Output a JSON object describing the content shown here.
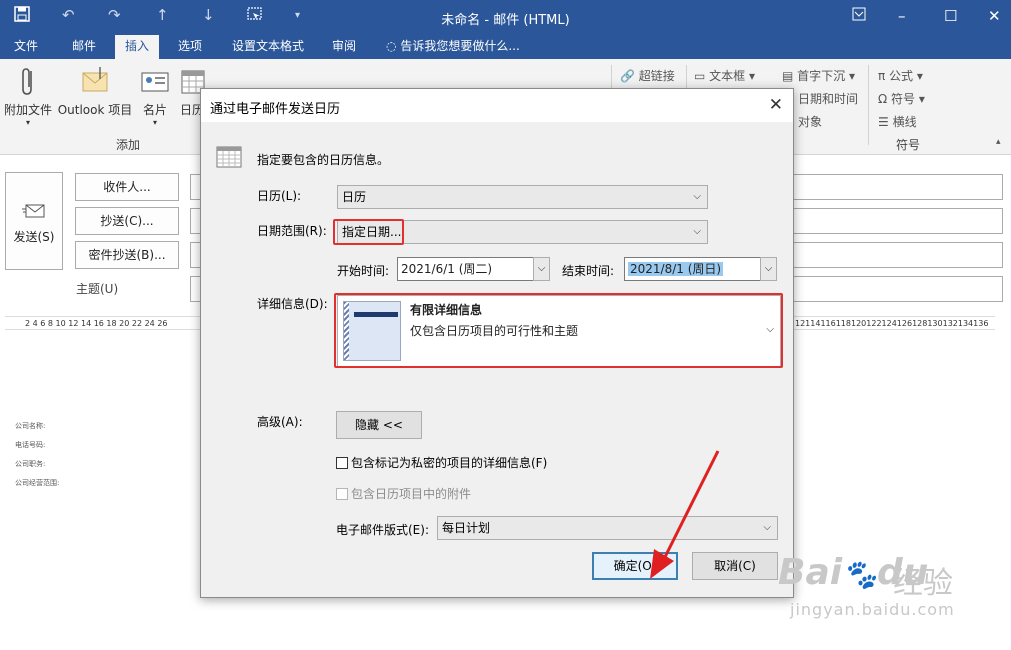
{
  "window": {
    "title": "未命名 - 邮件 (HTML)"
  },
  "ribbon_tabs": [
    "文件",
    "邮件",
    "插入",
    "选项",
    "设置文本格式",
    "审阅"
  ],
  "tell_me": "告诉我您想要做什么...",
  "ribbon": {
    "attach_file": "附加文件",
    "outlook_item": "Outlook 项目",
    "business_card": "名片",
    "calendar_short": "日历",
    "group_add": "添加",
    "hyperlink": "超链接",
    "textbox": "文本框",
    "dropcap": "首字下沉",
    "datetime": "日期和时间",
    "object": "对象",
    "equation": "公式",
    "symbol": "符号",
    "hline": "横线",
    "group_symbols": "符号"
  },
  "compose": {
    "send": "发送(S)",
    "to": "收件人...",
    "cc": "抄送(C)...",
    "bcc": "密件抄送(B)...",
    "subject": "主题(U)",
    "ruler_left": "2  4  6  8  10 12 14 16 18 20 22 24 26",
    "ruler_right": "12114116118120122124126128130132134136",
    "doc_lines": [
      "公司名称:",
      "电话号码:",
      "公司职务:",
      "公司经营范围:"
    ]
  },
  "dialog": {
    "title": "通过电子邮件发送日历",
    "intro": "指定要包含的日历信息。",
    "calendar_label": "日历(L):",
    "calendar_value": "日历",
    "range_label": "日期范围(R):",
    "range_value": "指定日期...",
    "start_label": "开始时间:",
    "start_value": "2021/6/1 (周二)",
    "end_label": "结束时间:",
    "end_value": "2021/8/1 (周日)",
    "detail_label": "详细信息(D):",
    "detail_title": "有限详细信息",
    "detail_desc": "仅包含日历项目的可行性和主题",
    "advanced_label": "高级(A):",
    "hide_button": "隐藏 <<",
    "private_check": "包含标记为私密的项目的详细信息(F)",
    "attach_check": "包含日历项目中的附件",
    "format_label": "电子邮件版式(E):",
    "format_value": "每日计划",
    "ok": "确定(O)",
    "cancel": "取消(C)"
  },
  "watermark": {
    "brand": "Bai",
    "brand2": "du",
    "cn": "经验",
    "url": "jingyan.baidu.com"
  },
  "colors": {
    "ribbon_blue": "#2b579a",
    "highlight_red": "#e03030",
    "selection": "#99c9ef"
  },
  "icons": [
    "save-icon",
    "undo-icon",
    "redo-icon",
    "up-icon",
    "down-icon",
    "touch-icon",
    "customize-icon",
    "lightbulb-icon",
    "restore-icon",
    "minimize-icon",
    "maximize-icon",
    "close-icon",
    "paperclip-icon",
    "outlook-item-icon",
    "business-card-icon",
    "calendar-icon",
    "send-icon",
    "dialog-calendar-icon",
    "chevron-down-icon"
  ]
}
